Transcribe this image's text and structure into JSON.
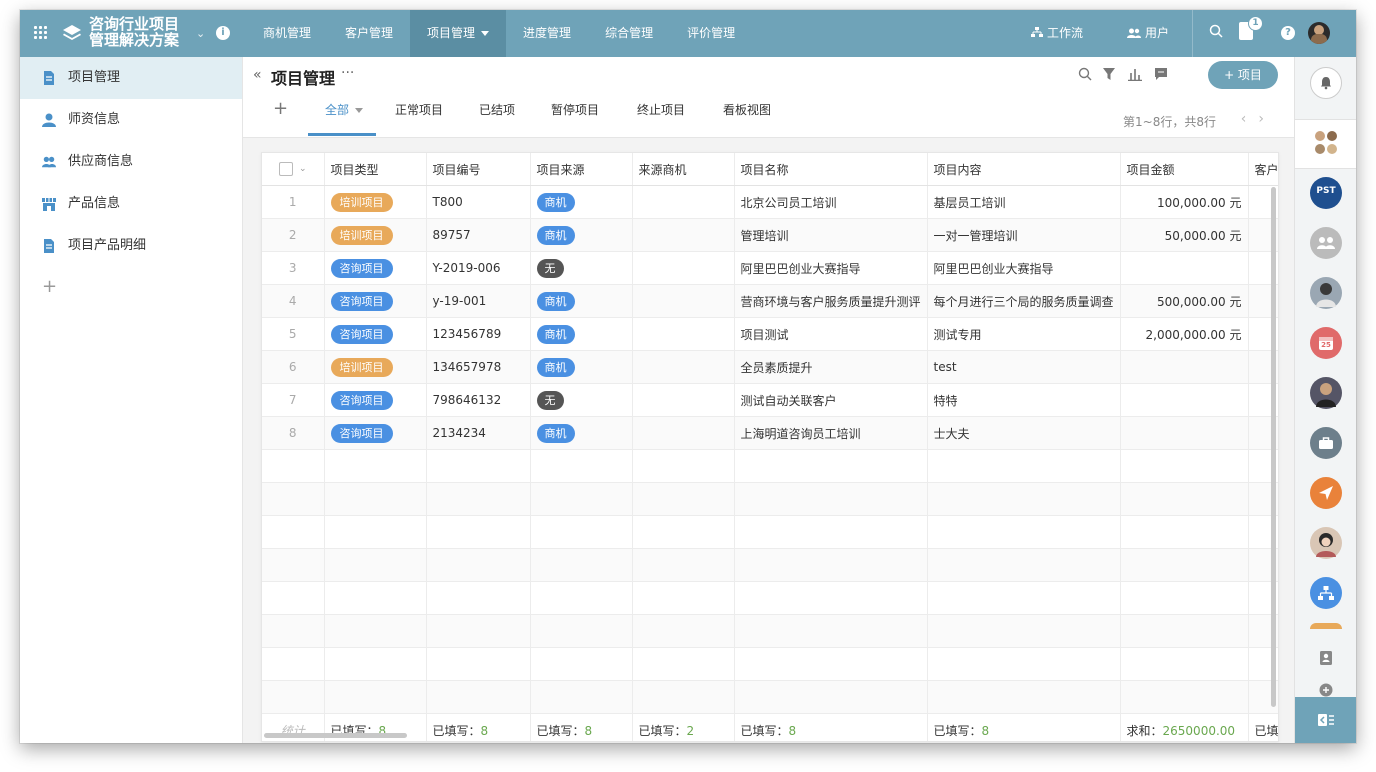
{
  "app": {
    "title": "咨询行业项目管理解决方案",
    "title_line1": "咨询行业项目",
    "title_line2": "管理解决方案",
    "info": "i"
  },
  "nav": [
    {
      "label": "商机管理",
      "active": false
    },
    {
      "label": "客户管理",
      "active": false
    },
    {
      "label": "项目管理",
      "active": true
    },
    {
      "label": "进度管理",
      "active": false
    },
    {
      "label": "综合管理",
      "active": false
    },
    {
      "label": "评价管理",
      "active": false
    }
  ],
  "topright": {
    "workflow": "工作流",
    "user": "用户",
    "notification_count": "1",
    "help": "?"
  },
  "sidebar": {
    "items": [
      {
        "label": "项目管理",
        "icon": "document-icon",
        "active": true
      },
      {
        "label": "师资信息",
        "icon": "person-icon",
        "active": false
      },
      {
        "label": "供应商信息",
        "icon": "people-icon",
        "active": false
      },
      {
        "label": "产品信息",
        "icon": "store-icon",
        "active": false
      },
      {
        "label": "项目产品明细",
        "icon": "document-icon",
        "active": false
      }
    ],
    "add": "+"
  },
  "page": {
    "collapse": "«",
    "title": "项目管理",
    "more": "···",
    "add_button": "+ 项目",
    "tab_add": "+",
    "tabs": [
      {
        "label": "全部",
        "active": true
      },
      {
        "label": "正常项目",
        "active": false
      },
      {
        "label": "已结项",
        "active": false
      },
      {
        "label": "暂停项目",
        "active": false
      },
      {
        "label": "终止项目",
        "active": false
      },
      {
        "label": "看板视图",
        "active": false
      }
    ],
    "pager": "第1~8行，共8行",
    "pager_prev": "‹",
    "pager_next": "›"
  },
  "table": {
    "columns": [
      "项目类型",
      "项目编号",
      "项目来源",
      "来源商机",
      "项目名称",
      "项目内容",
      "项目金额",
      "客户"
    ],
    "rows": [
      {
        "no": "1",
        "type": "培训项目",
        "type_kind": "train",
        "code": "T800",
        "source": "商机",
        "source_kind": "biz",
        "opportunity": "",
        "name": "北京公司员工培训",
        "content": "基层员工培训",
        "amount": "100,000.00 元"
      },
      {
        "no": "2",
        "type": "培训项目",
        "type_kind": "train",
        "code": "89757",
        "source": "商机",
        "source_kind": "biz",
        "opportunity": "",
        "name": "管理培训",
        "content": "一对一管理培训",
        "amount": "50,000.00 元"
      },
      {
        "no": "3",
        "type": "咨询项目",
        "type_kind": "consult",
        "code": "Y-2019-006",
        "source": "无",
        "source_kind": "none",
        "opportunity": "",
        "name": "阿里巴巴创业大赛指导",
        "content": "阿里巴巴创业大赛指导",
        "amount": ""
      },
      {
        "no": "4",
        "type": "咨询项目",
        "type_kind": "consult",
        "code": "y-19-001",
        "source": "商机",
        "source_kind": "biz",
        "opportunity": "",
        "name": "营商环境与客户服务质量提升测评",
        "content": "每个月进行三个局的服务质量调查",
        "amount": "500,000.00 元"
      },
      {
        "no": "5",
        "type": "咨询项目",
        "type_kind": "consult",
        "code": "123456789",
        "source": "商机",
        "source_kind": "biz",
        "opportunity": "",
        "name": "项目测试",
        "content": "测试专用",
        "amount": "2,000,000.00 元"
      },
      {
        "no": "6",
        "type": "培训项目",
        "type_kind": "train",
        "code": "134657978",
        "source": "商机",
        "source_kind": "biz",
        "opportunity": "",
        "name": "全员素质提升",
        "content": "test",
        "amount": ""
      },
      {
        "no": "7",
        "type": "咨询项目",
        "type_kind": "consult",
        "code": "798646132",
        "source": "无",
        "source_kind": "none",
        "opportunity": "",
        "name": "测试自动关联客户",
        "content": "特特",
        "amount": ""
      },
      {
        "no": "8",
        "type": "咨询项目",
        "type_kind": "consult",
        "code": "2134234",
        "source": "商机",
        "source_kind": "biz",
        "opportunity": "",
        "name": "上海明道咨询员工培训",
        "content": "士大夫",
        "amount": ""
      }
    ],
    "footer": {
      "label": "统计",
      "filled_label": "已填写：",
      "sum_label": "求和：",
      "type": "8",
      "code": "8",
      "source": "8",
      "opportunity": "2",
      "name": "8",
      "content": "8",
      "amount": "2650000.00",
      "customer": "已填"
    }
  },
  "rail": {
    "pst": "PST",
    "calendar_day": "25"
  },
  "colors": {
    "topbar": "#6fa3b8",
    "nav_active": "#5b8ea3",
    "train_pill": "#e8a95a",
    "consult_pill": "#4a90e2",
    "none_pill": "#555555",
    "footer_value": "#6aa84f"
  }
}
